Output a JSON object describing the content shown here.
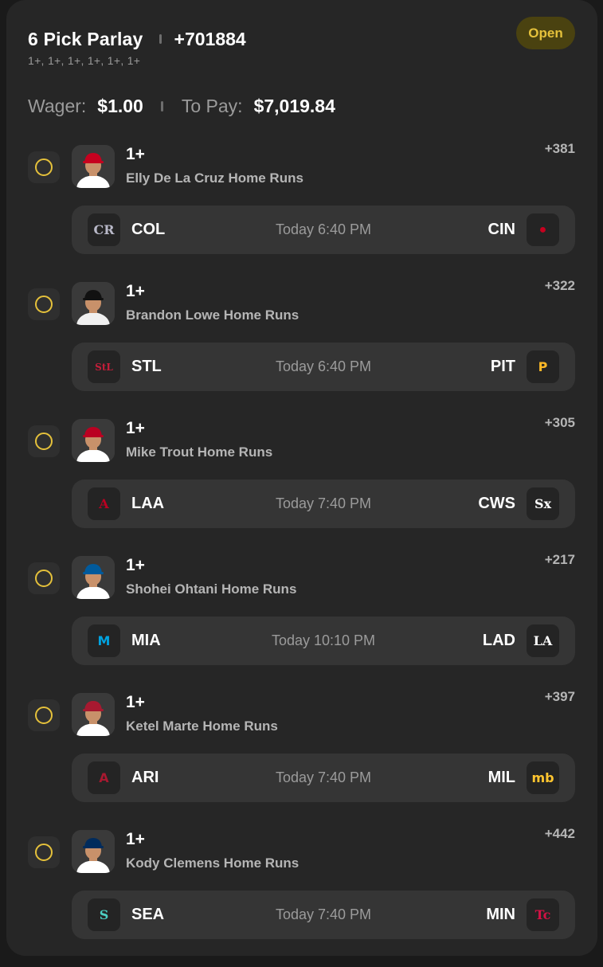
{
  "bet": {
    "title": "6 Pick Parlay",
    "total_odds": "+701884",
    "lines_summary": "1+, 1+, 1+, 1+, 1+, 1+",
    "status": "Open",
    "wager_label": "Wager:",
    "wager_value": "$1.00",
    "payout_label": "To Pay:",
    "payout_value": "$7,019.84"
  },
  "colors": {
    "accent": "#e5c13b",
    "card_bg": "#262626",
    "game_bg": "#353535"
  },
  "legs": [
    {
      "line": "1+",
      "market": "Elly De La Cruz Home Runs",
      "odds": "+381",
      "away": "COL",
      "home": "CIN",
      "time": "Today 6:40 PM",
      "away_icon": "rockies-logo-icon",
      "home_icon": "reds-logo-icon",
      "cap_color": "#c6011f",
      "jersey_color": "#ffffff"
    },
    {
      "line": "1+",
      "market": "Brandon Lowe Home Runs",
      "odds": "+322",
      "away": "STL",
      "home": "PIT",
      "time": "Today 6:40 PM",
      "away_icon": "cardinals-logo-icon",
      "home_icon": "pirates-logo-icon",
      "cap_color": "#111111",
      "jersey_color": "#f0f0f0"
    },
    {
      "line": "1+",
      "market": "Mike Trout Home Runs",
      "odds": "+305",
      "away": "LAA",
      "home": "CWS",
      "time": "Today 7:40 PM",
      "away_icon": "angels-logo-icon",
      "home_icon": "white-sox-logo-icon",
      "cap_color": "#ba0021",
      "jersey_color": "#ffffff"
    },
    {
      "line": "1+",
      "market": "Shohei Ohtani Home Runs",
      "odds": "+217",
      "away": "MIA",
      "home": "LAD",
      "time": "Today 10:10 PM",
      "away_icon": "marlins-logo-icon",
      "home_icon": "dodgers-logo-icon",
      "cap_color": "#005a9c",
      "jersey_color": "#ffffff"
    },
    {
      "line": "1+",
      "market": "Ketel Marte Home Runs",
      "odds": "+397",
      "away": "ARI",
      "home": "MIL",
      "time": "Today 7:40 PM",
      "away_icon": "diamondbacks-logo-icon",
      "home_icon": "brewers-logo-icon",
      "cap_color": "#a71930",
      "jersey_color": "#ffffff"
    },
    {
      "line": "1+",
      "market": "Kody Clemens Home Runs",
      "odds": "+442",
      "away": "SEA",
      "home": "MIN",
      "time": "Today 7:40 PM",
      "away_icon": "mariners-logo-icon",
      "home_icon": "twins-logo-icon",
      "cap_color": "#002b5c",
      "jersey_color": "#ffffff"
    }
  ]
}
